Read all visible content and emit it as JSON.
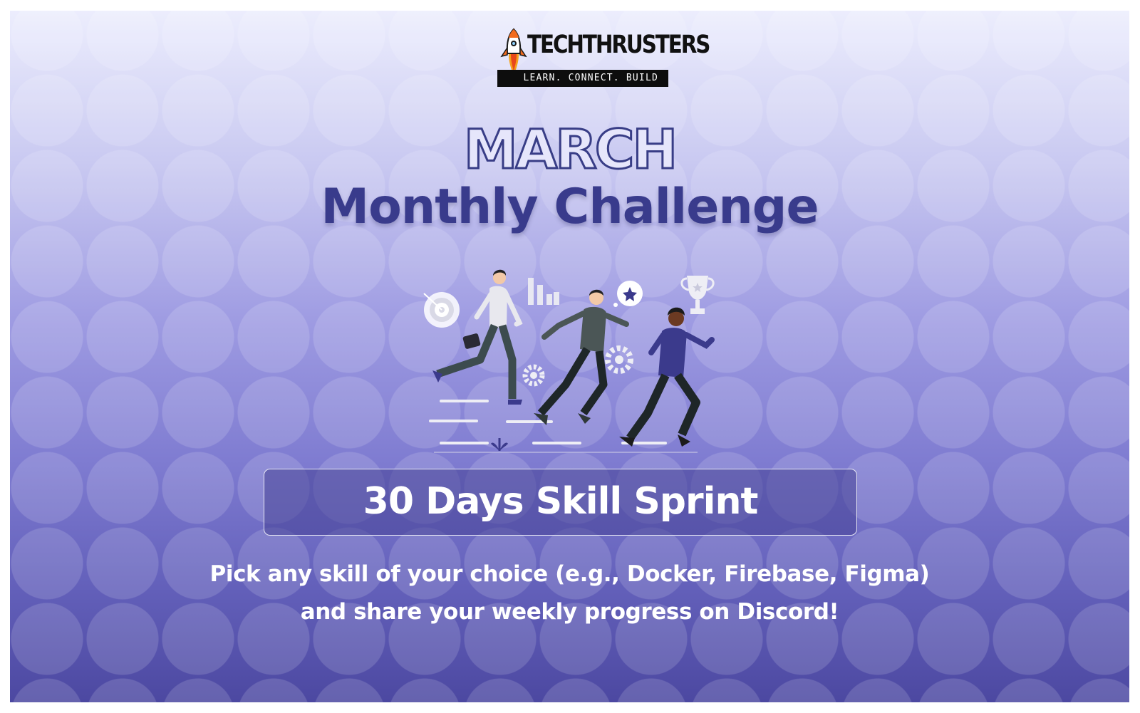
{
  "brand": {
    "name": "TECHTHRUSTERS",
    "tagline": "LEARN. CONNECT. BUILD"
  },
  "headline": {
    "month": "MARCH",
    "title": "Monthly Challenge"
  },
  "challenge": {
    "name": "30 Days Skill Sprint",
    "description": "Pick any skill of your choice (e.g., Docker, Firebase, Figma) and share your weekly progress on Discord!"
  },
  "colors": {
    "title_navy": "#393b8c",
    "outline_navy": "#383d86",
    "gradient_top": "#ecedfd",
    "gradient_bottom": "#4c48a1",
    "rocket_orange": "#f26b1d"
  }
}
